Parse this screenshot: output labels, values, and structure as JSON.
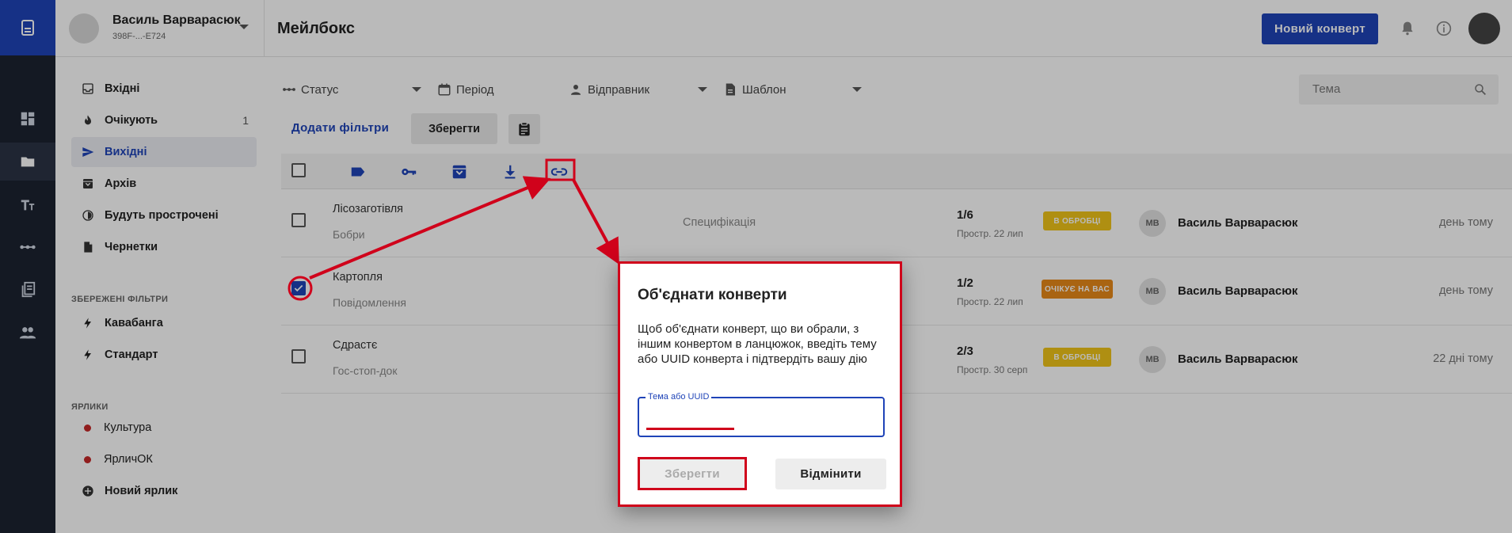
{
  "header": {
    "user_name": "Василь Варварасюк",
    "user_id": "398F-...-E724",
    "page_title": "Мейлбокс",
    "new_envelope_label": "Новий конверт"
  },
  "nav": {
    "items": [
      {
        "label": "Вхідні",
        "icon": "inbox-icon"
      },
      {
        "label": "Очікують",
        "icon": "flame-icon",
        "count": "1"
      },
      {
        "label": "Вихідні",
        "icon": "send-icon"
      },
      {
        "label": "Архів",
        "icon": "archive-icon"
      },
      {
        "label": "Будуть прострочені",
        "icon": "timer-icon"
      },
      {
        "label": "Чернетки",
        "icon": "draft-icon"
      }
    ],
    "saved_filters_title": "ЗБЕРЕЖЕНІ ФІЛЬТРИ",
    "saved_filters": [
      "Кавабанга",
      "Стандарт"
    ],
    "labels_title": "ЯРЛИКИ",
    "labels": [
      "Культура",
      "ЯрличОК"
    ],
    "new_label": "Новий ярлик",
    "label_color": "#c62828"
  },
  "filters": {
    "status": "Статус",
    "period": "Період",
    "sender": "Відправник",
    "template": "Шаблон",
    "search_placeholder": "Тема",
    "add_filters": "Додати фільтри",
    "save": "Зберегти"
  },
  "rows": [
    {
      "title": "Лісозаготівля",
      "subtitle": "Бобри",
      "template": "Специфікація",
      "count": "1/6",
      "expire": "Простр. 22 лип",
      "badge": "В ОБРОБЦІ",
      "badge_color": "#f0c419",
      "initials": "МВ",
      "sender": "Василь Варварасюк",
      "time": "день тому",
      "checked": false
    },
    {
      "title": "Картопля",
      "subtitle": "Повідомлення",
      "template": "",
      "count": "1/2",
      "expire": "Простр. 22 лип",
      "badge": "ОЧІКУЄ НА ВАС",
      "badge_color": "#e8891a",
      "initials": "МВ",
      "sender": "Василь Варварасюк",
      "time": "день тому",
      "checked": true
    },
    {
      "title": "Сдрастє",
      "subtitle": "Гос-стоп-док",
      "template": "",
      "count": "2/3",
      "expire": "Простр. 30 серп",
      "badge": "В ОБРОБЦІ",
      "badge_color": "#f0c419",
      "initials": "МВ",
      "sender": "Василь Варварасюк",
      "time": "22 дні тому",
      "checked": false
    }
  ],
  "dialog": {
    "title": "Об'єднати конверти",
    "text": "Щоб об'єднати конверт, що ви обрали, з іншим конвертом в ланцюжок, введіть тему або UUID конверта і підтвердіть вашу дію",
    "field_label": "Тема або UUID",
    "field_value": "",
    "save": "Зберегти",
    "cancel": "Відмінити"
  },
  "colors": {
    "accent": "#1f44b8",
    "annotation": "#d0021b"
  }
}
